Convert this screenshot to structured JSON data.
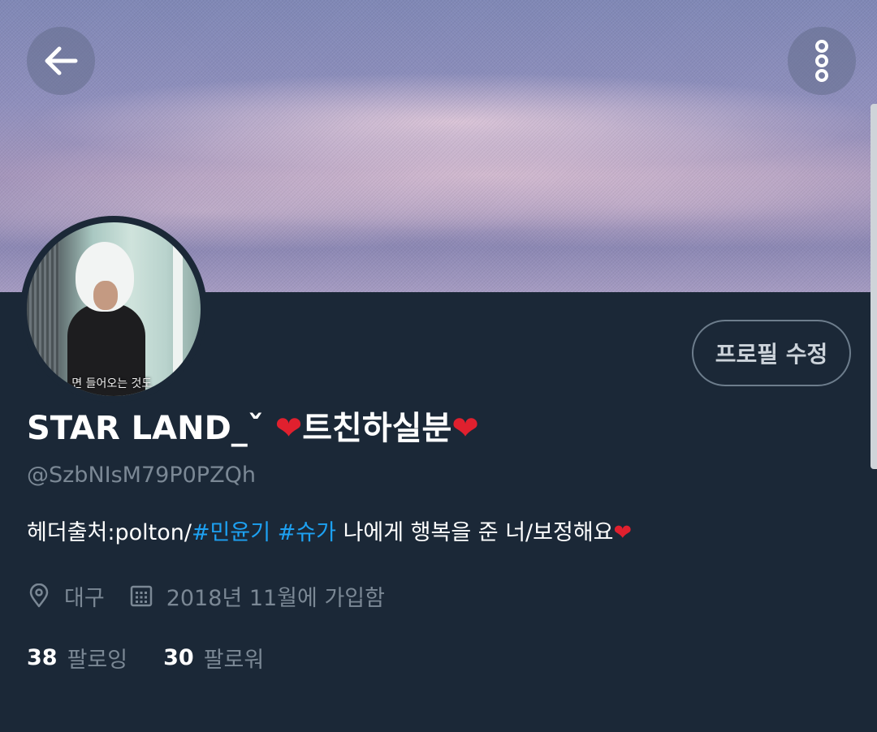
{
  "profile": {
    "display_name_prefix": "STAR LAND_ˇ ",
    "display_name_heart_1": "❤",
    "display_name_middle": "트친하실분",
    "display_name_heart_2": "❤",
    "handle": "@SzbNIsM79P0PZQh",
    "edit_button_label": "프로필 수정",
    "avatar_caption": "…면 들어오는 것도 …",
    "bio": {
      "prefix": "헤더출처:polton/",
      "hashtag_1": "#민윤기",
      "hashtag_2": "#슈가",
      "suffix": " 나에게 행복을 준 너/보정해요",
      "heart": "❤"
    },
    "location": "대구",
    "joined": "2018년 11월에 가입함",
    "following_count": "38",
    "following_label": "팔로잉",
    "followers_count": "30",
    "followers_label": "팔로워"
  },
  "icons": {
    "back": "arrow-left-icon",
    "more": "more-vertical-icon",
    "location": "location-pin-icon",
    "calendar": "calendar-icon"
  },
  "colors": {
    "background": "#1b2837",
    "hashtag": "#1da1f2",
    "secondary_text": "#7b8895",
    "heart": "#e0202e"
  }
}
